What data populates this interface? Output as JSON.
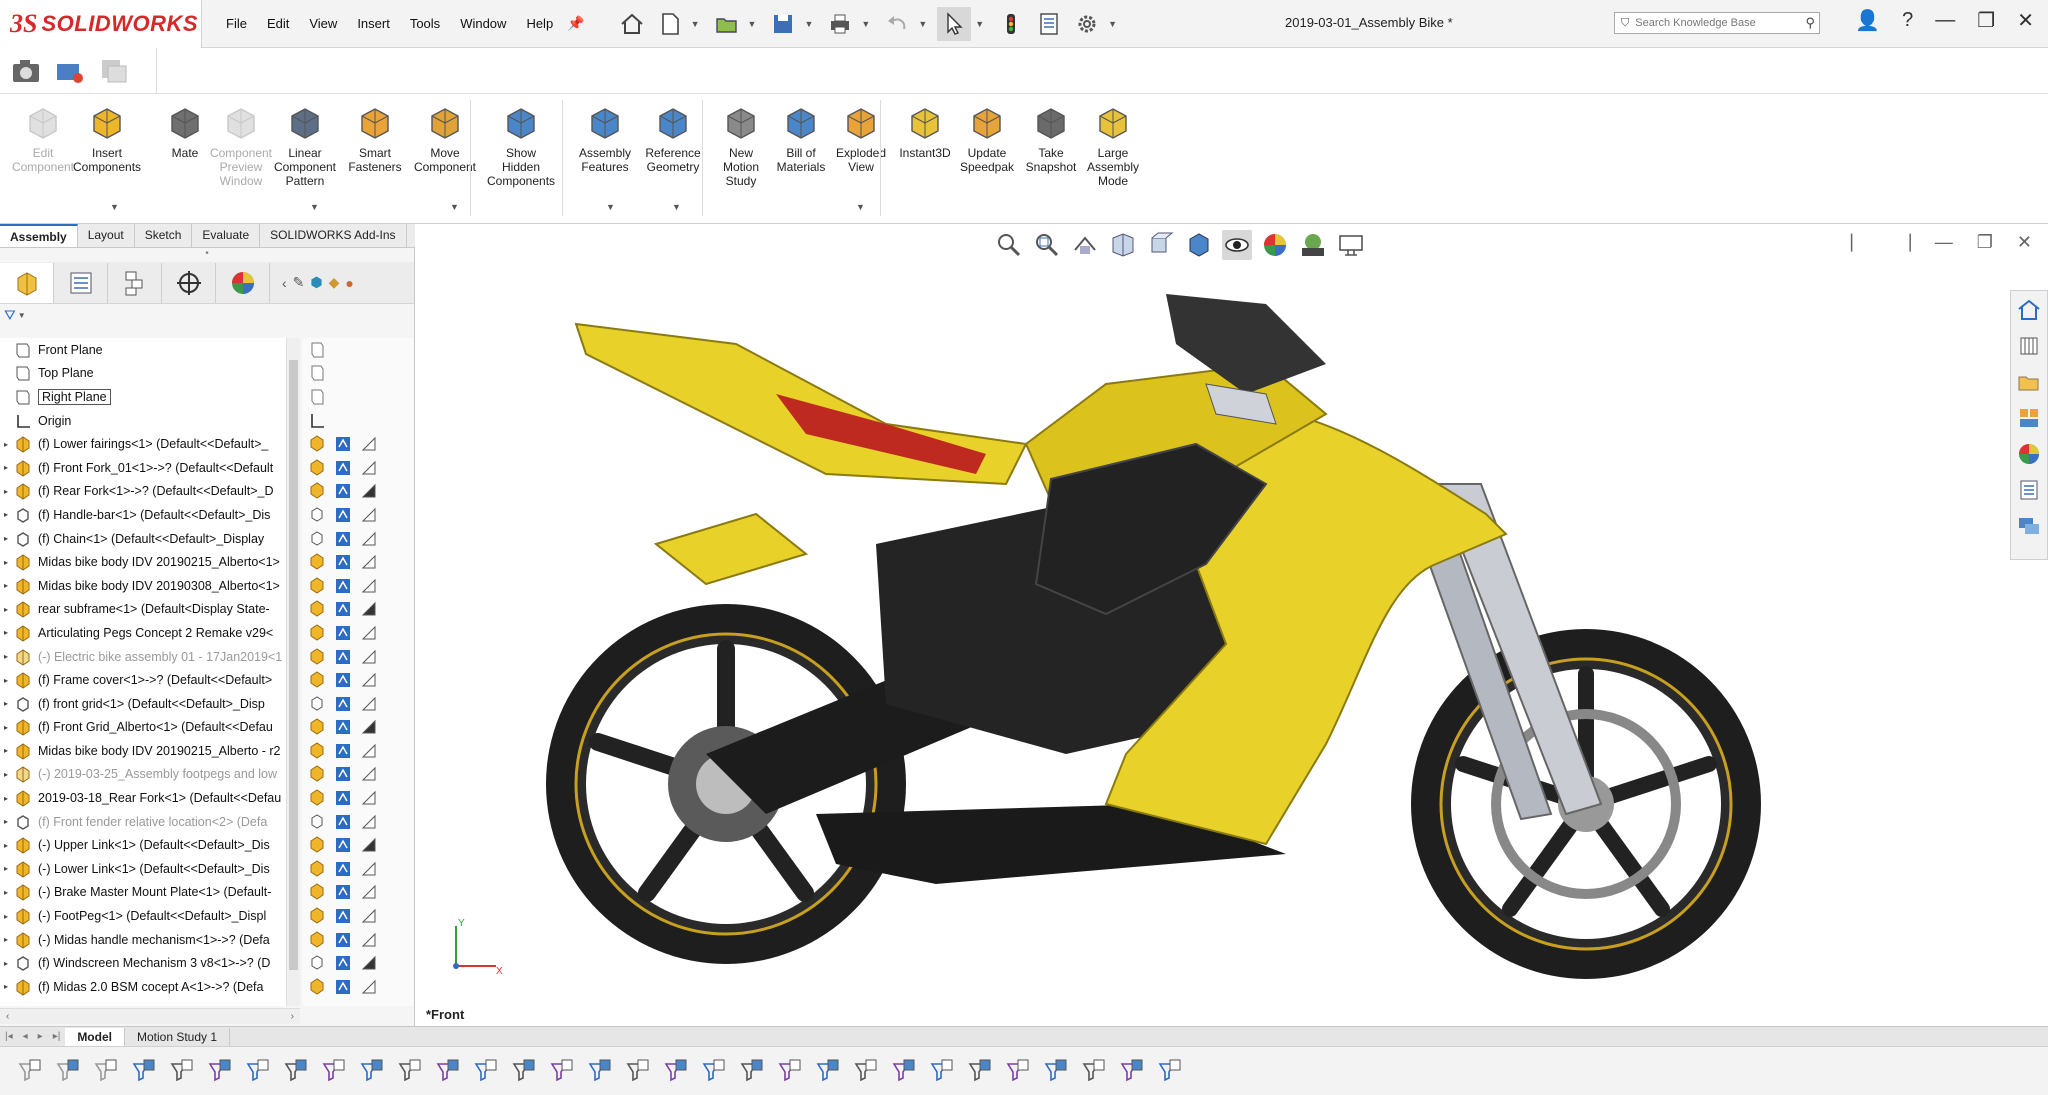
{
  "app": {
    "brand": "SOLIDWORKS",
    "brand_mark": "3S",
    "document_title": "2019-03-01_Assembly Bike *"
  },
  "menu": [
    "File",
    "Edit",
    "View",
    "Insert",
    "Tools",
    "Window",
    "Help"
  ],
  "search": {
    "placeholder": "Search Knowledge Base"
  },
  "ribbon": [
    {
      "label": "Edit Component",
      "lines": [
        "Edit",
        "Component"
      ],
      "enabled": false,
      "icon": "edit-component-icon"
    },
    {
      "label": "Insert Components",
      "lines": [
        "Insert",
        "Components"
      ],
      "enabled": true,
      "icon": "insert-components-icon"
    },
    {
      "label": "Mate",
      "lines": [
        "Mate"
      ],
      "enabled": true,
      "icon": "mate-icon"
    },
    {
      "label": "Component Preview Window",
      "lines": [
        "Component",
        "Preview",
        "Window"
      ],
      "enabled": false,
      "icon": "component-preview-icon"
    },
    {
      "label": "Linear Component Pattern",
      "lines": [
        "Linear",
        "Component",
        "Pattern"
      ],
      "enabled": true,
      "icon": "linear-pattern-icon"
    },
    {
      "label": "Smart Fasteners",
      "lines": [
        "Smart",
        "Fasteners"
      ],
      "enabled": true,
      "icon": "smart-fasteners-icon"
    },
    {
      "label": "Move Component",
      "lines": [
        "Move",
        "Component"
      ],
      "enabled": true,
      "icon": "move-component-icon"
    },
    {
      "label": "Show Hidden Components",
      "lines": [
        "Show",
        "Hidden",
        "Components"
      ],
      "enabled": true,
      "icon": "show-hidden-icon"
    },
    {
      "label": "Assembly Features",
      "lines": [
        "Assembly",
        "Features"
      ],
      "enabled": true,
      "icon": "assembly-features-icon"
    },
    {
      "label": "Reference Geometry",
      "lines": [
        "Reference",
        "Geometry"
      ],
      "enabled": true,
      "icon": "reference-geometry-icon"
    },
    {
      "label": "New Motion Study",
      "lines": [
        "New",
        "Motion",
        "Study"
      ],
      "enabled": true,
      "icon": "motion-study-icon"
    },
    {
      "label": "Bill of Materials",
      "lines": [
        "Bill of",
        "Materials"
      ],
      "enabled": true,
      "icon": "bom-icon"
    },
    {
      "label": "Exploded View",
      "lines": [
        "Exploded",
        "View"
      ],
      "enabled": true,
      "icon": "exploded-view-icon"
    },
    {
      "label": "Instant3D",
      "lines": [
        "Instant3D"
      ],
      "enabled": true,
      "icon": "instant3d-icon"
    },
    {
      "label": "Update Speedpak",
      "lines": [
        "Update",
        "Speedpak"
      ],
      "enabled": true,
      "icon": "speedpak-icon"
    },
    {
      "label": "Take Snapshot",
      "lines": [
        "Take",
        "Snapshot"
      ],
      "enabled": true,
      "icon": "snapshot-icon"
    },
    {
      "label": "Large Assembly Mode",
      "lines": [
        "Large",
        "Assembly",
        "Mode"
      ],
      "enabled": true,
      "icon": "large-assembly-icon"
    }
  ],
  "command_tabs": [
    "Assembly",
    "Layout",
    "Sketch",
    "Evaluate",
    "SOLIDWORKS Add-Ins"
  ],
  "tree": [
    {
      "label": "Front Plane",
      "icon": "plane-icon",
      "expand": false,
      "state": "normal"
    },
    {
      "label": "Top Plane",
      "icon": "plane-icon",
      "expand": false,
      "state": "normal"
    },
    {
      "label": "Right Plane",
      "icon": "plane-icon",
      "expand": false,
      "state": "selected"
    },
    {
      "label": "Origin",
      "icon": "origin-icon",
      "expand": false,
      "state": "normal"
    },
    {
      "label": "(f) Lower fairings<1> (Default<<Default>_",
      "icon": "subassembly-icon",
      "expand": true,
      "state": "normal"
    },
    {
      "label": "(f) Front Fork_01<1>->? (Default<<Default",
      "icon": "subassembly-icon",
      "expand": true,
      "state": "normal"
    },
    {
      "label": "(f) Rear Fork<1>->? (Default<<Default>_D",
      "icon": "subassembly-icon",
      "expand": true,
      "state": "normal"
    },
    {
      "label": "(f) Handle-bar<1> (Default<<Default>_Dis",
      "icon": "part-icon",
      "expand": true,
      "state": "normal"
    },
    {
      "label": "(f) Chain<1> (Default<<Default>_Display",
      "icon": "part-icon",
      "expand": true,
      "state": "normal"
    },
    {
      "label": "Midas bike body IDV 20190215_Alberto<1>",
      "icon": "subassembly-icon",
      "expand": true,
      "state": "normal"
    },
    {
      "label": "Midas bike body IDV 20190308_Alberto<1>",
      "icon": "subassembly-icon",
      "expand": true,
      "state": "normal"
    },
    {
      "label": "rear subframe<1> (Default<Display State-",
      "icon": "subassembly-icon",
      "expand": true,
      "state": "normal"
    },
    {
      "label": "Articulating Pegs Concept 2 Remake v29<",
      "icon": "subassembly-icon",
      "expand": true,
      "state": "normal"
    },
    {
      "label": "(-) Electric bike assembly 01 - 17Jan2019<1",
      "icon": "subassembly-icon",
      "expand": true,
      "state": "faded"
    },
    {
      "label": "(f) Frame cover<1>->? (Default<<Default>",
      "icon": "subassembly-icon",
      "expand": true,
      "state": "normal"
    },
    {
      "label": "(f) front grid<1> (Default<<Default>_Disp",
      "icon": "part-icon",
      "expand": true,
      "state": "normal"
    },
    {
      "label": "(f) Front Grid_Alberto<1> (Default<<Defau",
      "icon": "subassembly-icon",
      "expand": true,
      "state": "normal"
    },
    {
      "label": "Midas bike body IDV 20190215_Alberto - r2",
      "icon": "subassembly-icon",
      "expand": true,
      "state": "normal"
    },
    {
      "label": "(-) 2019-03-25_Assembly footpegs and low",
      "icon": "subassembly-icon",
      "expand": true,
      "state": "faded"
    },
    {
      "label": "2019-03-18_Rear Fork<1> (Default<<Defau",
      "icon": "subassembly-icon",
      "expand": true,
      "state": "normal"
    },
    {
      "label": "(f) Front fender relative location<2> (Defa",
      "icon": "part-icon",
      "expand": true,
      "state": "faded"
    },
    {
      "label": "(-) Upper Link<1> (Default<<Default>_Dis",
      "icon": "subassembly-icon",
      "expand": true,
      "state": "normal"
    },
    {
      "label": "(-) Lower Link<1> (Default<<Default>_Dis",
      "icon": "subassembly-icon",
      "expand": true,
      "state": "normal"
    },
    {
      "label": "(-) Brake Master Mount Plate<1> (Default-",
      "icon": "subassembly-icon",
      "expand": true,
      "state": "normal"
    },
    {
      "label": "(-) FootPeg<1> (Default<<Default>_Displ",
      "icon": "subassembly-icon",
      "expand": true,
      "state": "normal"
    },
    {
      "label": "(-) Midas handle mechanism<1>->? (Defa",
      "icon": "subassembly-icon",
      "expand": true,
      "state": "normal"
    },
    {
      "label": "(f) Windscreen Mechanism 3 v8<1>->? (D",
      "icon": "part-icon",
      "expand": true,
      "state": "normal"
    },
    {
      "label": "(f) Midas 2.0 BSM cocept A<1>->? (Defa",
      "icon": "subassembly-icon",
      "expand": true,
      "state": "normal"
    }
  ],
  "viewport": {
    "view_name": "*Front",
    "model_color": "#e8d22a",
    "accent": "#2d6cc4"
  },
  "bottom_tabs": [
    "Model",
    "Motion Study 1"
  ]
}
